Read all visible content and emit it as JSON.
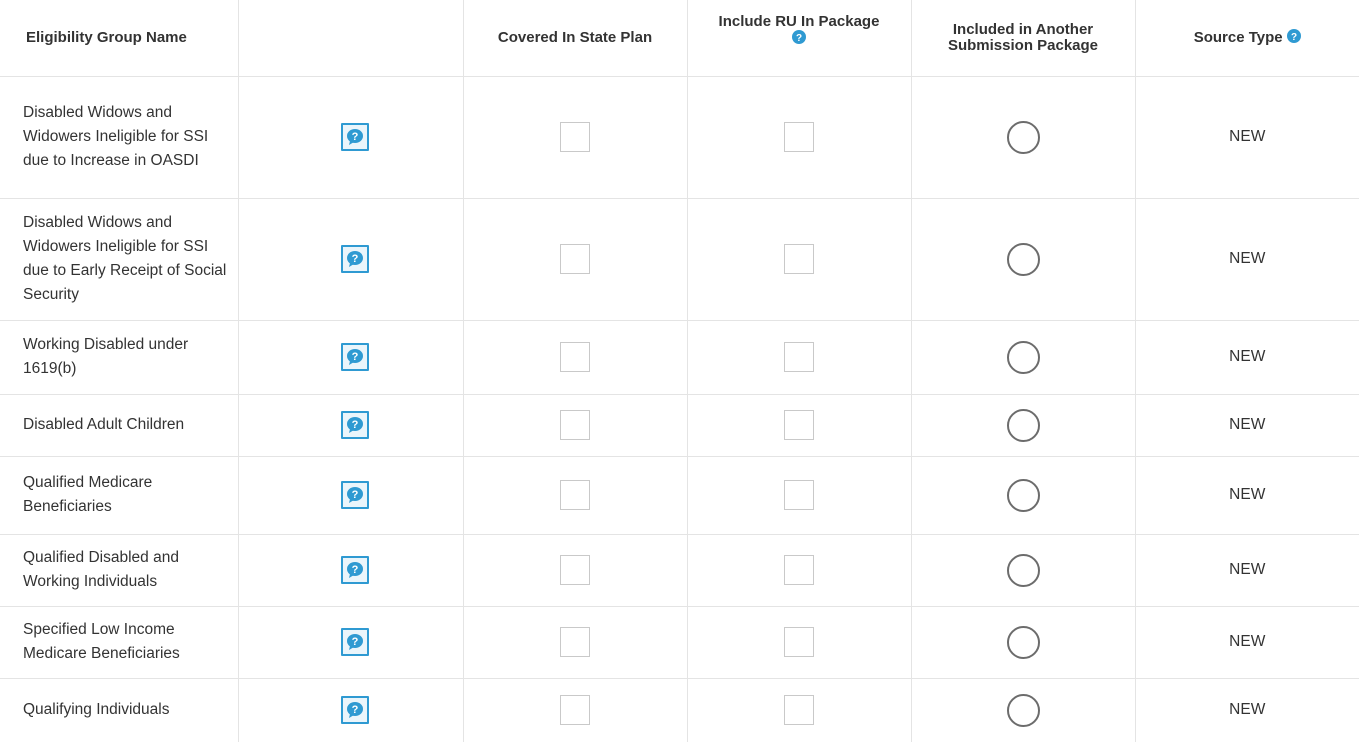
{
  "table": {
    "headers": {
      "name": "Eligibility Group Name",
      "info": "",
      "covered": "Covered In State Plan",
      "include_ru": "Include RU In Package",
      "included_other": "Included in Another Submission Package",
      "source_type": "Source Type"
    },
    "header_icons": {
      "include_ru": "question-circle-icon",
      "source_type": "question-circle-icon"
    },
    "row_icon": "speech-bubble-question-icon",
    "accent_color": "#2f9ad2",
    "rows": [
      {
        "name": "Disabled Widows and Widowers Ineligible for SSI due to Increase in OASDI",
        "covered": false,
        "include_ru": false,
        "included_other": false,
        "source_type": "NEW"
      },
      {
        "name": "Disabled Widows and Widowers Ineligible for SSI due to Early Receipt of Social Security",
        "covered": false,
        "include_ru": false,
        "included_other": false,
        "source_type": "NEW"
      },
      {
        "name": "Working Disabled under 1619(b)",
        "covered": false,
        "include_ru": false,
        "included_other": false,
        "source_type": "NEW"
      },
      {
        "name": "Disabled Adult Children",
        "covered": false,
        "include_ru": false,
        "included_other": false,
        "source_type": "NEW"
      },
      {
        "name": "Qualified Medicare Beneficiaries",
        "covered": false,
        "include_ru": false,
        "included_other": false,
        "source_type": "NEW"
      },
      {
        "name": "Qualified Disabled and Working Individuals",
        "covered": false,
        "include_ru": false,
        "included_other": false,
        "source_type": "NEW"
      },
      {
        "name": "Specified Low Income Medicare Beneficiaries",
        "covered": false,
        "include_ru": false,
        "included_other": false,
        "source_type": "NEW"
      },
      {
        "name": "Qualifying Individuals",
        "covered": false,
        "include_ru": false,
        "included_other": false,
        "source_type": "NEW"
      }
    ]
  }
}
